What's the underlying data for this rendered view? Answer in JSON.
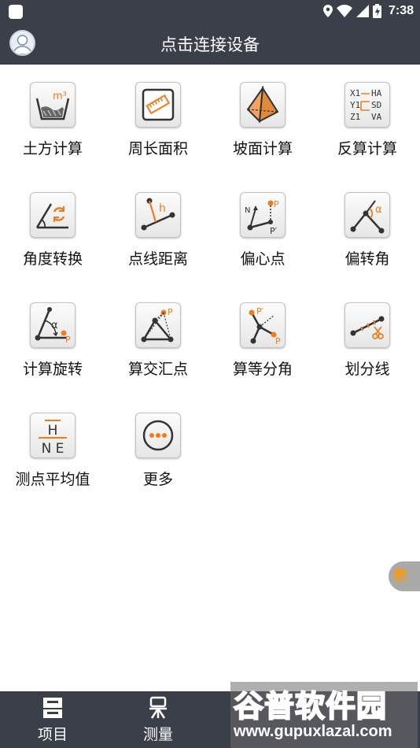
{
  "status_bar": {
    "time": "7:38"
  },
  "header": {
    "title": "点击连接设备"
  },
  "tools": [
    {
      "label": "土方计算",
      "icon": "earthwork-icon"
    },
    {
      "label": "周长面积",
      "icon": "perimeter-area-icon"
    },
    {
      "label": "坡面计算",
      "icon": "slope-icon"
    },
    {
      "label": "反算计算",
      "icon": "inverse-calc-icon"
    },
    {
      "label": "角度转换",
      "icon": "angle-convert-icon"
    },
    {
      "label": "点线距离",
      "icon": "point-line-distance-icon"
    },
    {
      "label": "偏心点",
      "icon": "eccentric-point-icon"
    },
    {
      "label": "偏转角",
      "icon": "deflection-angle-icon"
    },
    {
      "label": "计算旋转",
      "icon": "rotation-icon"
    },
    {
      "label": "算交汇点",
      "icon": "intersection-icon"
    },
    {
      "label": "算等分角",
      "icon": "bisector-icon"
    },
    {
      "label": "划分线",
      "icon": "divide-line-icon"
    },
    {
      "label": "测点平均值",
      "icon": "point-average-icon"
    },
    {
      "label": "更多",
      "icon": "more-icon"
    }
  ],
  "icon_text": {
    "earthwork_unit": "m³",
    "inverse_rows": [
      [
        "X1",
        "HA"
      ],
      [
        "Y1",
        "SD"
      ],
      [
        "Z1",
        "VA"
      ]
    ],
    "h": "h",
    "p": "P",
    "p_prime": "P′",
    "n": "N",
    "alpha": "α",
    "avg_top": "H",
    "avg_bottom": "N E"
  },
  "float_button": {
    "label": "教"
  },
  "bottom_nav": [
    {
      "label": "项目",
      "icon": "project-icon"
    },
    {
      "label": "测量",
      "icon": "measure-icon"
    }
  ],
  "watermark": {
    "text": "谷普软件园",
    "url": "www.gupuxlazal.com"
  },
  "colors": {
    "bar": "#3a3f4a",
    "accent": "#f07c1c",
    "watermark_green": "#7ec23a"
  }
}
